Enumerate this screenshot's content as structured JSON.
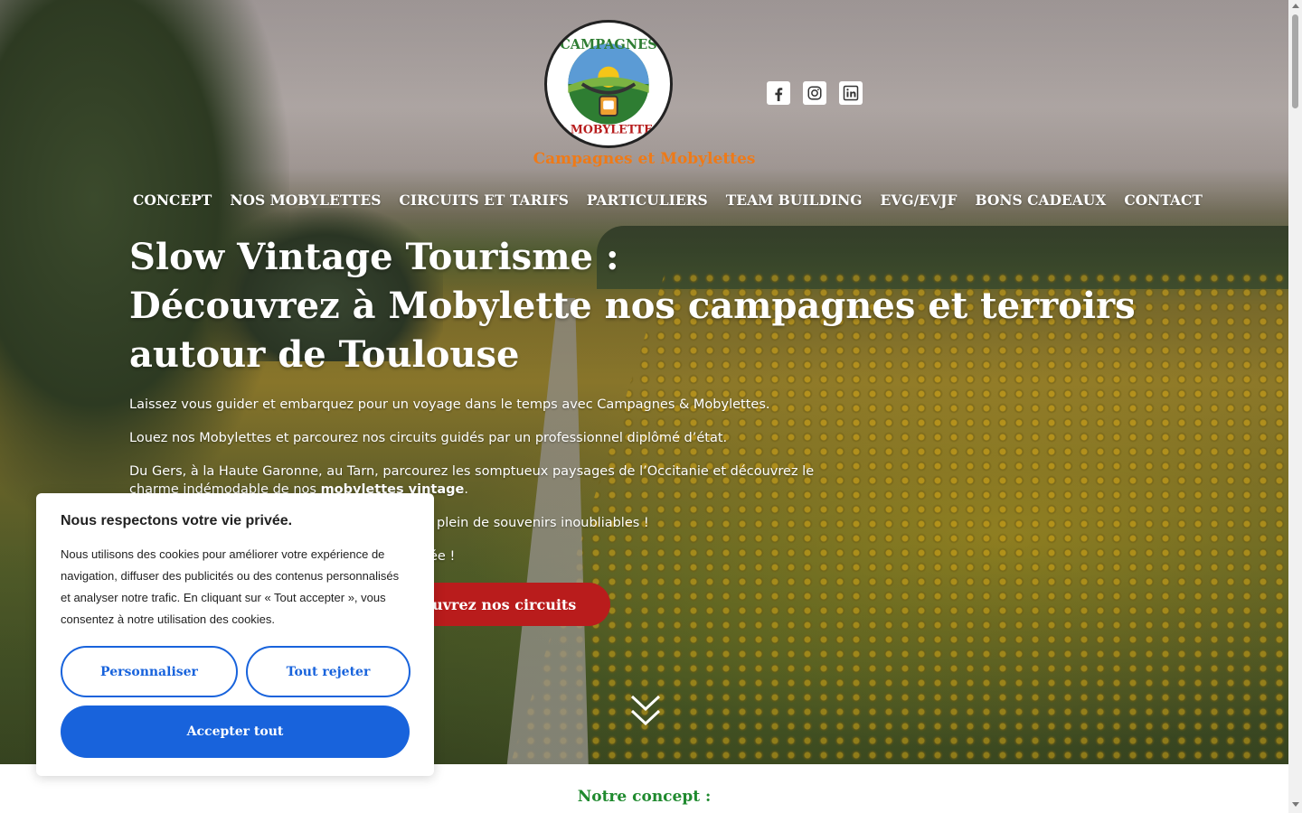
{
  "brand": {
    "name": "Campagnes et Mobylettes",
    "logo_top": "CAMPAGNES",
    "logo_bottom": "& MOBYLETTES"
  },
  "socials": [
    {
      "icon": "facebook-icon"
    },
    {
      "icon": "instagram-icon"
    },
    {
      "icon": "linkedin-icon"
    }
  ],
  "nav": {
    "items": [
      {
        "label": "CONCEPT"
      },
      {
        "label": "NOS MOBYLETTES"
      },
      {
        "label": "CIRCUITS ET TARIFS"
      },
      {
        "label": "PARTICULIERS"
      },
      {
        "label": "TEAM BUILDING"
      },
      {
        "label": "EVG/EVJF"
      },
      {
        "label": "BONS CADEAUX"
      },
      {
        "label": "CONTACT"
      }
    ]
  },
  "hero": {
    "headline_line1": "Slow Vintage Tourisme :",
    "headline_line2": "Découvrez à Mobylette nos campagnes et terroirs autour de Toulouse",
    "p1": "Laissez vous guider et embarquez pour un voyage dans le temps avec Campagnes & Mobylettes.",
    "p2": "Louez nos Mobylettes et parcourez nos circuits guidés par un professionnel diplômé d’état.",
    "p3_before": "Du Gers, à la Haute Garonne, au Tarn, parcourez les somptueux paysages de l’Occitanie et découvrez le charme indémodable de nos ",
    "p3_strong": "mobylettes vintage",
    "p3_after": ".",
    "p4": "plein de souvenirs inoubliables !",
    "p5": "ée !",
    "cta_label": "couvrez nos circuits"
  },
  "concept": {
    "title": "Notre concept :"
  },
  "cookie": {
    "title": "Nous respectons votre vie privée.",
    "body": "Nous utilisons des cookies pour améliorer votre expérience de navigation, diffuser des publicités ou des contenus personnalisés et analyser notre trafic. En cliquant sur « Tout accepter », vous consentez à notre utilisation des cookies.",
    "customize_label": "Personnaliser",
    "reject_label": "Tout rejeter",
    "accept_label": "Accepter tout"
  },
  "colors": {
    "brand_orange": "#ef7a17",
    "cta_red": "#b91c1c",
    "cookie_blue": "#1863dc",
    "concept_green": "#1f8a2e"
  }
}
